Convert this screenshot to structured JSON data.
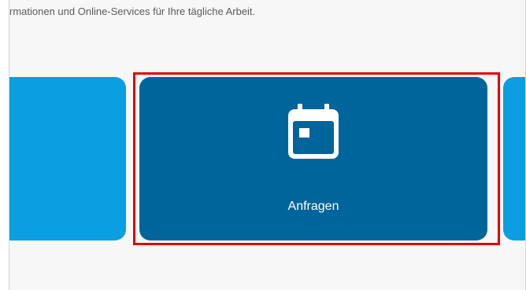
{
  "intro": {
    "text": "rmationen und Online-Services für Ihre tägliche Arbeit."
  },
  "tiles": {
    "main": {
      "label": "Anfragen",
      "icon": "calendar-icon"
    }
  },
  "colors": {
    "tile_active": "#00659a",
    "tile_default": "#0b9ee0",
    "highlight": "#e20000"
  }
}
